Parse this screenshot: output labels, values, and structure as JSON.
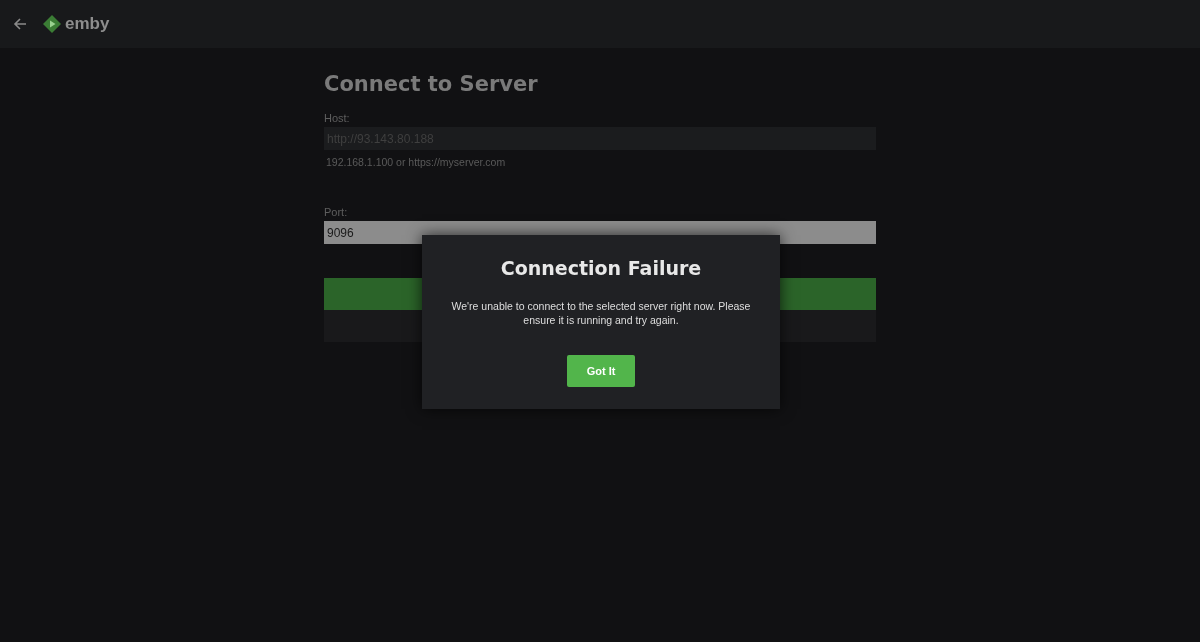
{
  "header": {
    "brand": "emby"
  },
  "form": {
    "title": "Connect to Server",
    "fields": [
      {
        "label": "Host:",
        "value": "http://93.143.80.188",
        "hint": "192.168.1.100 or https://myserver.com",
        "kind": "text"
      },
      {
        "label": "Port:",
        "value": "9096",
        "kind": "filled"
      }
    ]
  },
  "dialog": {
    "title": "Connection Failure",
    "message": "We're unable to connect to the selected server right now. Please ensure it is running and try again.",
    "button": "Got It"
  }
}
